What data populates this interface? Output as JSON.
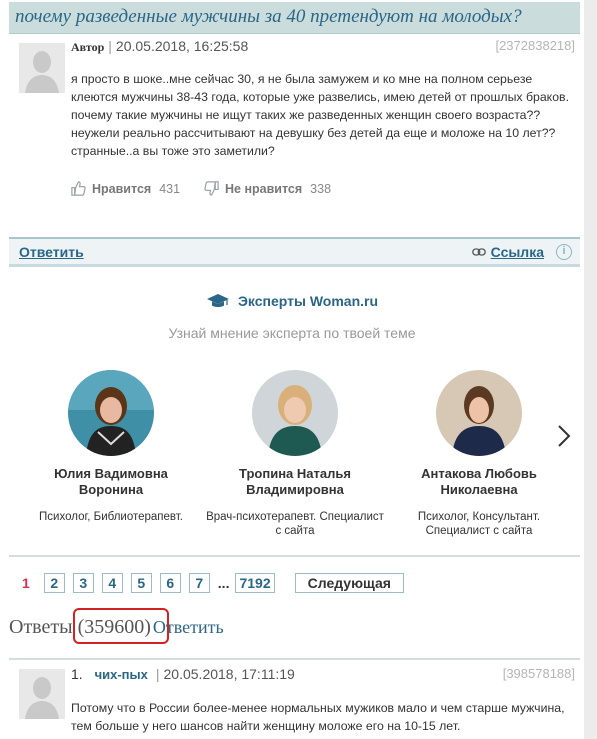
{
  "topic": {
    "title": "почему разведенные мужчины за 40 претендуют на молодых?"
  },
  "post": {
    "author_label": "Автор",
    "date": "20.05.2018, 16:25:58",
    "id": "[2372838218]",
    "text": "я просто в шоке..мне сейчас 30, я не была замужем и ко мне на полном серьезе клеются мужчины 38-43 года, которые уже развелись, имею детей от прошлых браков. почему такие мужчины не ищут таких же разведенных женщин своего возраста?? неужели реально рассчитывают на девушку без детей да еще и моложе на 10 лет?? странные..а вы тоже это заметили?",
    "like_label": "Нравится",
    "like_count": "431",
    "dislike_label": "Не нравится",
    "dislike_count": "338"
  },
  "actions": {
    "reply_label": "Ответить",
    "link_label": "Ссылка",
    "info_icon": "i"
  },
  "experts": {
    "title": "Эксперты Woman.ru",
    "subtitle": "Узнай мнение эксперта по твоей теме",
    "items": [
      {
        "name": "Юлия Вадимовна Воронина",
        "role": "Психолог, Библиотерапевт."
      },
      {
        "name": "Тропина Наталья Владимировна",
        "role": "Врач-психотерапевт. Специалист с сайта"
      },
      {
        "name": "Антакова Любовь Николаевна",
        "role": "Психолог, Консультант. Специалист с сайта"
      }
    ]
  },
  "pagination": {
    "current": "1",
    "pages": [
      "2",
      "3",
      "4",
      "5",
      "6",
      "7"
    ],
    "dots": "...",
    "last": "7192",
    "next_label": "Следующая"
  },
  "answers": {
    "label": "Ответы",
    "count": "(359600)",
    "reply_label": "Ответить",
    "highlight_color": "#d42222"
  },
  "first_reply": {
    "num": "1.",
    "nick": "чих-пых",
    "date": "20.05.2018, 17:11:19",
    "id": "[398578188]",
    "text": "Потому что в России более-менее нормальных мужиков мало и чем старше мужчина, тем больше у него шансов найти женщину моложе его на 10-15 лет."
  },
  "colors": {
    "link": "#2a6687",
    "title_bg": "#cbdcdc",
    "current_page": "#d9304d"
  }
}
